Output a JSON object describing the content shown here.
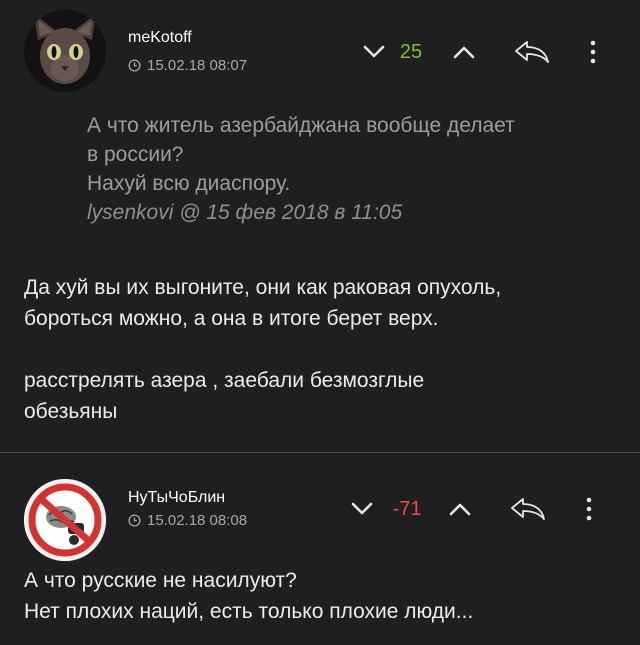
{
  "comments": [
    {
      "author": "meKotoff",
      "timestamp": "15.02.18 08:07",
      "score": "25",
      "score_color": "#7fbf3a",
      "avatar_icon": "sphynx-cat-avatar",
      "quote": {
        "lines": [
          "А что житель азербайджана вообще делает",
          "в россии?",
          "Нахуй всю диаспору."
        ],
        "source_user": "lysenkovi",
        "source_rest": " @ 15 фев 2018 в 11:05"
      },
      "body": [
        "Да хуй вы их выгоните, они как раковая опухоль,",
        "бороться можно, а она в итоге берет верх.",
        "",
        "расстрелять азера , заебали безмозглые",
        "обезьяны"
      ]
    },
    {
      "author": "НуТыЧоБлин",
      "timestamp": "15.02.18 08:08",
      "score": "-71",
      "score_color": "#e0524a",
      "avatar_icon": "no-brain-sign-avatar",
      "body": [
        "А что русские не насилуют?",
        "Нет плохих наций, есть только плохие люди..."
      ]
    }
  ]
}
